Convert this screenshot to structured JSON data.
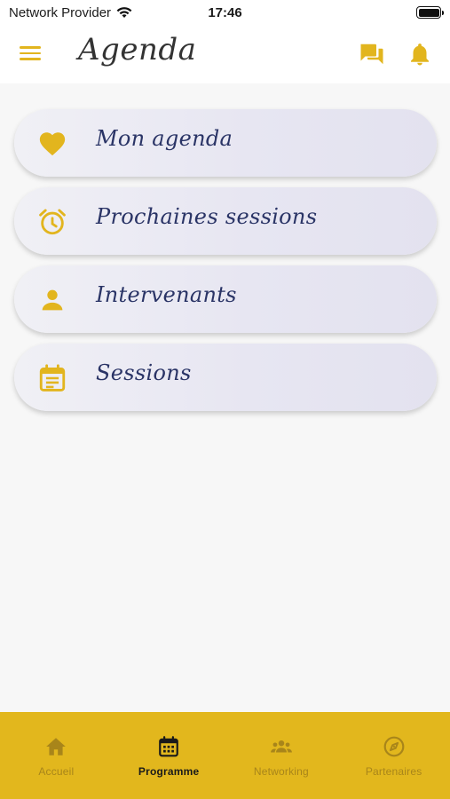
{
  "status_bar": {
    "carrier": "Network Provider",
    "time": "17:46"
  },
  "header": {
    "title": "Agenda"
  },
  "menu": [
    {
      "label": "Mon agenda",
      "icon": "heart-icon"
    },
    {
      "label": "Prochaines sessions",
      "icon": "alarm-clock-icon"
    },
    {
      "label": "Intervenants",
      "icon": "person-icon"
    },
    {
      "label": "Sessions",
      "icon": "calendar-note-icon"
    }
  ],
  "tabs": [
    {
      "label": "Accueil",
      "icon": "home-icon",
      "active": false
    },
    {
      "label": "Programme",
      "icon": "calendar-icon",
      "active": true
    },
    {
      "label": "Networking",
      "icon": "people-icon",
      "active": false
    },
    {
      "label": "Partenaires",
      "icon": "compass-icon",
      "active": false
    }
  ],
  "colors": {
    "accent": "#e2b51e",
    "tabbar": "#e2b71d",
    "card_text": "#2a3466"
  }
}
